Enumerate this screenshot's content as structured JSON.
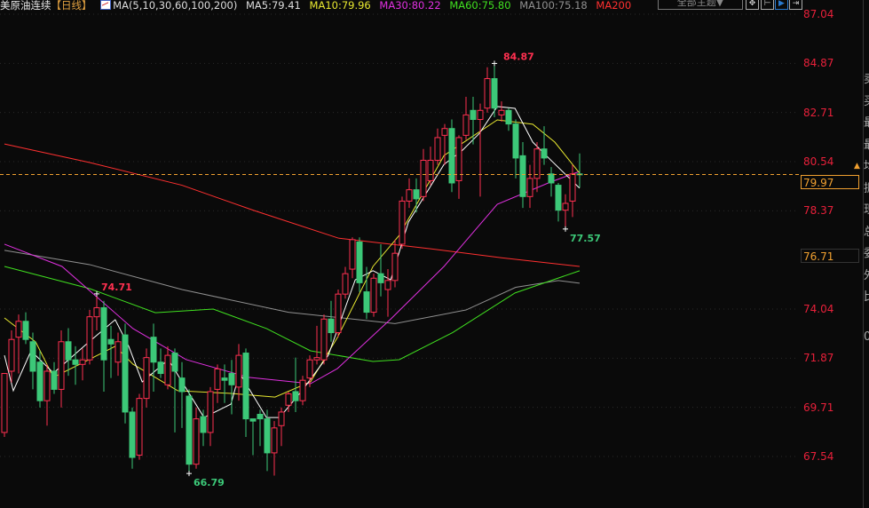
{
  "header": {
    "title": "美原油连续",
    "period": "【日线】",
    "ma_params": "MA(5,10,30,60,100,200)",
    "ma5": "MA5:79.41",
    "ma10": "MA10:79.96",
    "ma30": "MA30:80.22",
    "ma60": "MA60:75.80",
    "ma100": "MA100:75.18",
    "ma200": "MA200",
    "theme_button": "全部主题▼",
    "tools": [
      "crosshair-icon",
      "axis-icon",
      "play-icon",
      "expand-icon"
    ]
  },
  "colors": {
    "up": "#ff3050",
    "down": "#3cc878",
    "ma5": "#ffffff",
    "ma10": "#e8e830",
    "ma30": "#e030e0",
    "ma60": "#40e020",
    "ma100": "#909090",
    "ma200": "#ff3030",
    "current": "#f0a030"
  },
  "side_panel": [
    "卖",
    "买",
    "最",
    "最",
    "均",
    "振",
    "现",
    "总",
    "委",
    "外",
    "比",
    "",
    "0"
  ],
  "chart_data": {
    "type": "candlestick",
    "y_ticks": [
      "87.04",
      "84.87",
      "82.71",
      "80.54",
      "78.37",
      "74.04",
      "71.87",
      "69.71",
      "67.54"
    ],
    "ylim": [
      67.54,
      87.04
    ],
    "current_price": "79.97",
    "reference_price": "76.71",
    "annotations": {
      "high": "84.87",
      "low_left": "66.79",
      "high_left": "74.71",
      "low_right": "77.57"
    },
    "ohlc": [
      [
        68.6,
        71.2,
        68.4,
        71.2
      ],
      [
        71.3,
        73.1,
        70.8,
        72.7
      ],
      [
        72.8,
        73.8,
        71.2,
        73.5
      ],
      [
        73.5,
        73.9,
        72.5,
        72.7
      ],
      [
        72.6,
        73.0,
        70.5,
        71.3
      ],
      [
        71.7,
        72.2,
        69.7,
        70.0
      ],
      [
        70.0,
        71.6,
        68.9,
        71.3
      ],
      [
        71.3,
        71.7,
        70.3,
        70.5
      ],
      [
        70.5,
        73.1,
        69.7,
        72.6
      ],
      [
        72.6,
        73.2,
        71.1,
        71.8
      ],
      [
        71.8,
        72.4,
        70.7,
        71.6
      ],
      [
        71.6,
        72.3,
        70.9,
        71.8
      ],
      [
        71.8,
        74.0,
        71.6,
        73.7
      ],
      [
        73.7,
        74.71,
        73.1,
        74.1
      ],
      [
        74.1,
        74.4,
        70.4,
        71.8
      ],
      [
        72.7,
        73.3,
        71.0,
        72.5
      ],
      [
        71.7,
        73.0,
        71.1,
        72.6
      ],
      [
        72.9,
        73.4,
        69.0,
        69.5
      ],
      [
        69.5,
        69.7,
        67.0,
        67.5
      ],
      [
        67.6,
        70.3,
        67.4,
        70.1
      ],
      [
        70.1,
        72.3,
        69.7,
        71.9
      ],
      [
        72.8,
        73.4,
        70.4,
        71.7
      ],
      [
        71.7,
        72.3,
        71.0,
        71.2
      ],
      [
        70.7,
        72.4,
        70.5,
        72.0
      ],
      [
        72.1,
        72.3,
        68.6,
        71.3
      ],
      [
        71.0,
        71.7,
        68.8,
        70.4
      ],
      [
        70.2,
        70.5,
        66.79,
        67.2
      ],
      [
        67.2,
        69.7,
        67.0,
        69.2
      ],
      [
        69.3,
        69.6,
        68.0,
        68.6
      ],
      [
        68.6,
        70.6,
        68.0,
        70.4
      ],
      [
        70.5,
        71.6,
        69.9,
        71.4
      ],
      [
        71.0,
        71.6,
        69.9,
        70.9
      ],
      [
        71.2,
        71.8,
        69.4,
        70.7
      ],
      [
        70.6,
        72.5,
        70.0,
        72.0
      ],
      [
        72.1,
        72.3,
        68.4,
        69.2
      ],
      [
        69.2,
        69.2,
        67.6,
        69.1
      ],
      [
        69.4,
        69.6,
        68.0,
        69.2
      ],
      [
        69.2,
        69.6,
        66.9,
        67.7
      ],
      [
        67.7,
        69.1,
        66.7,
        68.8
      ],
      [
        68.9,
        69.7,
        68.0,
        69.5
      ],
      [
        69.8,
        70.4,
        69.5,
        70.3
      ],
      [
        70.4,
        71.9,
        69.5,
        70.0
      ],
      [
        70.0,
        71.1,
        69.8,
        70.9
      ],
      [
        71.0,
        72.0,
        70.6,
        71.8
      ],
      [
        71.8,
        73.3,
        71.6,
        71.9
      ],
      [
        71.8,
        73.8,
        71.6,
        73.6
      ],
      [
        73.6,
        74.4,
        72.6,
        73.0
      ],
      [
        73.0,
        74.9,
        72.8,
        74.7
      ],
      [
        74.7,
        75.9,
        74.5,
        75.6
      ],
      [
        75.8,
        77.2,
        75.4,
        77.1
      ],
      [
        77.0,
        77.2,
        74.8,
        75.2
      ],
      [
        74.8,
        75.9,
        73.6,
        73.9
      ],
      [
        73.9,
        75.6,
        73.7,
        75.4
      ],
      [
        75.6,
        76.9,
        74.6,
        75.2
      ],
      [
        74.9,
        75.8,
        73.7,
        75.3
      ],
      [
        75.3,
        77.1,
        75.0,
        76.5
      ],
      [
        76.9,
        79.0,
        76.7,
        78.8
      ],
      [
        78.8,
        79.8,
        78.5,
        79.3
      ],
      [
        79.3,
        79.8,
        78.3,
        78.9
      ],
      [
        79.0,
        81.1,
        78.8,
        80.6
      ],
      [
        79.7,
        81.2,
        79.5,
        80.6
      ],
      [
        80.6,
        82.0,
        80.4,
        81.6
      ],
      [
        81.7,
        82.2,
        80.4,
        82.0
      ],
      [
        82.0,
        82.4,
        79.2,
        79.6
      ],
      [
        79.7,
        81.7,
        78.9,
        81.6
      ],
      [
        81.7,
        83.4,
        81.5,
        82.6
      ],
      [
        82.8,
        83.4,
        81.3,
        82.4
      ],
      [
        82.4,
        83.1,
        79.0,
        82.8
      ],
      [
        82.9,
        84.7,
        82.7,
        84.2
      ],
      [
        84.2,
        84.87,
        82.5,
        82.9
      ],
      [
        82.6,
        83.2,
        82.3,
        82.8
      ],
      [
        82.8,
        82.9,
        81.9,
        82.2
      ],
      [
        82.2,
        82.4,
        79.8,
        80.7
      ],
      [
        80.8,
        81.4,
        78.5,
        79.0
      ],
      [
        79.0,
        80.4,
        78.5,
        79.8
      ],
      [
        79.8,
        81.4,
        79.2,
        81.1
      ],
      [
        81.1,
        82.1,
        80.4,
        80.7
      ],
      [
        80.0,
        80.3,
        79.0,
        79.6
      ],
      [
        79.5,
        79.6,
        77.9,
        78.4
      ],
      [
        78.4,
        79.1,
        77.57,
        78.7
      ],
      [
        78.8,
        80.4,
        78.1,
        80.0
      ],
      [
        80.0,
        80.9,
        79.4,
        79.97
      ]
    ],
    "ma_series": {
      "ma200": [
        [
          0,
          81.32
        ],
        [
          12,
          80.5
        ],
        [
          25,
          79.5
        ],
        [
          35,
          78.4
        ],
        [
          47,
          77.17
        ],
        [
          60,
          76.7
        ],
        [
          70,
          76.3
        ],
        [
          81,
          75.92
        ]
      ],
      "ma100": [
        [
          0,
          76.63
        ],
        [
          12,
          76.0
        ],
        [
          25,
          74.9
        ],
        [
          40,
          73.9
        ],
        [
          55,
          73.4
        ],
        [
          65,
          74.0
        ],
        [
          72,
          75.0
        ],
        [
          78,
          75.3
        ],
        [
          81,
          75.18
        ]
      ],
      "ma60": [
        [
          0,
          75.92
        ],
        [
          12,
          74.94
        ],
        [
          21.25,
          73.88
        ],
        [
          29.4,
          74.04
        ],
        [
          36.9,
          73.18
        ],
        [
          43.1,
          72.2
        ],
        [
          51.9,
          71.73
        ],
        [
          55.6,
          71.81
        ],
        [
          63.1,
          73.0
        ],
        [
          71.9,
          74.75
        ],
        [
          81,
          75.73
        ]
      ],
      "ma30": [
        [
          0,
          76.9
        ],
        [
          8.1,
          75.92
        ],
        [
          13.1,
          74.55
        ],
        [
          18.1,
          73.18
        ],
        [
          25.6,
          71.81
        ],
        [
          34.4,
          71.03
        ],
        [
          43.1,
          70.75
        ],
        [
          46.9,
          71.42
        ],
        [
          54.4,
          73.6
        ],
        [
          61.9,
          75.92
        ],
        [
          69.4,
          78.66
        ],
        [
          76.9,
          79.64
        ],
        [
          81,
          80.11
        ]
      ],
      "ma10": [
        [
          0,
          73.65
        ],
        [
          4.4,
          72.59
        ],
        [
          6.9,
          71.03
        ],
        [
          11.9,
          71.81
        ],
        [
          15.6,
          72.4
        ],
        [
          18.1,
          71.61
        ],
        [
          24.4,
          70.44
        ],
        [
          31.9,
          70.32
        ],
        [
          38.1,
          70.16
        ],
        [
          43.1,
          70.83
        ],
        [
          46.9,
          72.79
        ],
        [
          51.9,
          75.92
        ],
        [
          55.6,
          77.29
        ],
        [
          61.9,
          80.81
        ],
        [
          69.4,
          82.38
        ],
        [
          74.4,
          82.19
        ],
        [
          77.5,
          81.4
        ],
        [
          81,
          80.03
        ]
      ],
      "ma5": [
        [
          0,
          72.0
        ],
        [
          1.25,
          70.44
        ],
        [
          3.75,
          72.2
        ],
        [
          6.9,
          71.22
        ],
        [
          11.9,
          72.59
        ],
        [
          15.6,
          73.57
        ],
        [
          17.5,
          72.4
        ],
        [
          19.4,
          70.83
        ],
        [
          23.1,
          71.81
        ],
        [
          28.1,
          69.26
        ],
        [
          31.9,
          69.85
        ],
        [
          33.1,
          71.22
        ],
        [
          36.9,
          69.26
        ],
        [
          38.75,
          69.26
        ],
        [
          41.9,
          70.44
        ],
        [
          45.6,
          72.0
        ],
        [
          49.4,
          75.33
        ],
        [
          51.9,
          75.73
        ],
        [
          54.4,
          75.33
        ],
        [
          56.9,
          77.88
        ],
        [
          61.9,
          80.42
        ],
        [
          64.4,
          81.01
        ],
        [
          66.9,
          81.79
        ],
        [
          69.4,
          82.97
        ],
        [
          71.9,
          82.89
        ],
        [
          74.4,
          81.4
        ],
        [
          76.9,
          80.62
        ],
        [
          81,
          79.37
        ]
      ]
    }
  }
}
